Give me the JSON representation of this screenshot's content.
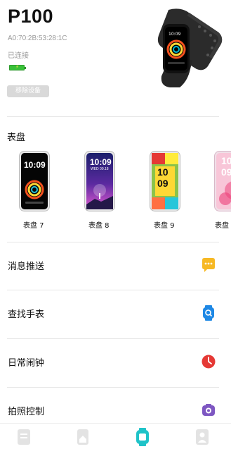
{
  "device": {
    "name": "P100",
    "mac": "A0:70:2B:53:28:1C",
    "status": "已连接",
    "remove_label": "移除设备",
    "colors": {
      "battery": "#39c239",
      "accent": "#1fc3c8"
    }
  },
  "watchfaces": {
    "title": "表盘",
    "items": [
      {
        "label": "表盘 7",
        "time": "10:09",
        "style": "rings"
      },
      {
        "label": "表盘 8",
        "time": "10:09",
        "date": "WED 09.18",
        "style": "night-sky"
      },
      {
        "label": "表盘 9",
        "time": "10",
        "time2": "09",
        "style": "color-blocks"
      },
      {
        "label": "表盘",
        "time": "10",
        "time2": "09",
        "style": "flower"
      }
    ]
  },
  "menu": [
    {
      "label": "消息推送",
      "icon": "message-icon",
      "color": "#f7b924"
    },
    {
      "label": "查找手表",
      "icon": "find-watch-icon",
      "color": "#1e88e5"
    },
    {
      "label": "日常闹钟",
      "icon": "alarm-clock-icon",
      "color": "#e53935"
    },
    {
      "label": "拍照控制",
      "icon": "camera-icon",
      "color": "#7e57c2"
    }
  ],
  "tabs": [
    {
      "name": "tab-home",
      "icon": "document-icon",
      "active": false
    },
    {
      "name": "tab-activity",
      "icon": "house-icon",
      "active": false
    },
    {
      "name": "tab-device",
      "icon": "watch-icon",
      "active": true
    },
    {
      "name": "tab-profile",
      "icon": "person-icon",
      "active": false
    }
  ]
}
